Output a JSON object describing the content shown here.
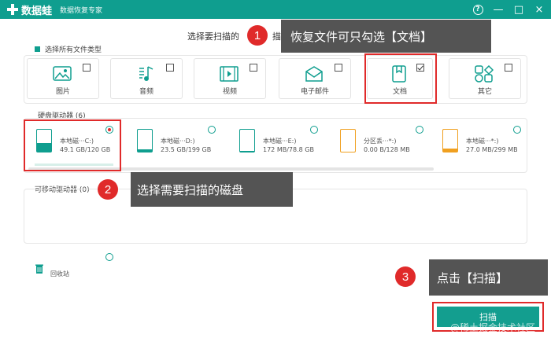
{
  "app": {
    "name": "数据蛙",
    "subtitle": "数据恢复专家"
  },
  "window_buttons": {
    "help": "?",
    "minimize": "—",
    "restore": "□",
    "close": "×"
  },
  "prompt": "选择要扫描的",
  "prompt_tail": "描",
  "select_all": "选择所有文件类型",
  "file_types": [
    {
      "label": "图片",
      "checked": false,
      "icon": "image-icon"
    },
    {
      "label": "音频",
      "checked": false,
      "icon": "music-icon"
    },
    {
      "label": "视频",
      "checked": false,
      "icon": "video-icon"
    },
    {
      "label": "电子邮件",
      "checked": false,
      "icon": "mail-icon"
    },
    {
      "label": "文档",
      "checked": true,
      "icon": "document-icon"
    },
    {
      "label": "其它",
      "checked": false,
      "icon": "other-icon"
    }
  ],
  "disk_section": {
    "title": "硬盘驱动器 (6)"
  },
  "disks": [
    {
      "name": "本地磁···C:)",
      "size": "49.1 GB/120 GB",
      "selected": true,
      "used": 0.41,
      "color": "#0f9e8f"
    },
    {
      "name": "本地磁···D:)",
      "size": "23.5 GB/199 GB",
      "selected": false,
      "used": 0.12,
      "color": "#0f9e8f"
    },
    {
      "name": "本地磁···E:)",
      "size": "172 MB/78.8 GB",
      "selected": false,
      "used": 0.02,
      "color": "#0f9e8f"
    },
    {
      "name": "分区丢···*:)",
      "size": "0.00  B/128 MB",
      "selected": false,
      "used": 0.0,
      "color": "#f0a020"
    },
    {
      "name": "本地磁···*:)",
      "size": "27.0 MB/299 MB",
      "selected": false,
      "used": 0.09,
      "color": "#f0a020"
    }
  ],
  "removable_section": {
    "title": "可移动驱动器 (0)"
  },
  "recycle": {
    "label": "回收站"
  },
  "callouts": [
    {
      "number": "1",
      "text": "恢复文件可只勾选【文档】"
    },
    {
      "number": "2",
      "text": "选择需要扫描的磁盘"
    },
    {
      "number": "3",
      "text": "点击【扫描】"
    }
  ],
  "scan_button": {
    "label": "扫描"
  },
  "watermark": "@稀土掘金技术社区",
  "colors": {
    "accent": "#0f9e8f",
    "highlight": "#e02a2a",
    "callout_bg": "#545454",
    "orange": "#f0a020"
  }
}
